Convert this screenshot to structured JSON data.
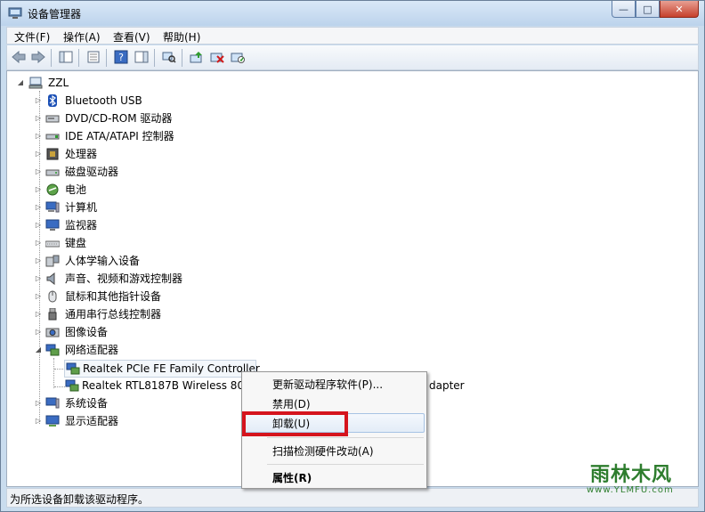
{
  "window": {
    "title": "设备管理器",
    "min": "—",
    "max": "□",
    "close": "✕"
  },
  "menu": [
    "文件(F)",
    "操作(A)",
    "查看(V)",
    "帮助(H)"
  ],
  "tree": {
    "root": "ZZL",
    "categories": [
      "Bluetooth USB",
      "DVD/CD-ROM 驱动器",
      "IDE ATA/ATAPI 控制器",
      "处理器",
      "磁盘驱动器",
      "电池",
      "计算机",
      "监视器",
      "键盘",
      "人体学输入设备",
      "声音、视频和游戏控制器",
      "鼠标和其他指针设备",
      "通用串行总线控制器",
      "图像设备",
      "网络适配器",
      "系统设备",
      "显示适配器"
    ],
    "network_children": [
      "Realtek PCIe FE Family Controller",
      "Realtek RTL8187B Wireless 802"
    ],
    "network_child2_tail": "dapter"
  },
  "context_menu": {
    "update": "更新驱动程序软件(P)...",
    "disable": "禁用(D)",
    "uninstall": "卸载(U)",
    "scan": "扫描检测硬件改动(A)",
    "properties": "属性(R)"
  },
  "status": "为所选设备卸载该驱动程序。",
  "watermark": {
    "brand": "雨林木风",
    "url": "www.YLMFU.com"
  },
  "colors": {
    "highlight": "#d5141d",
    "accent": "#2e7d2e"
  }
}
